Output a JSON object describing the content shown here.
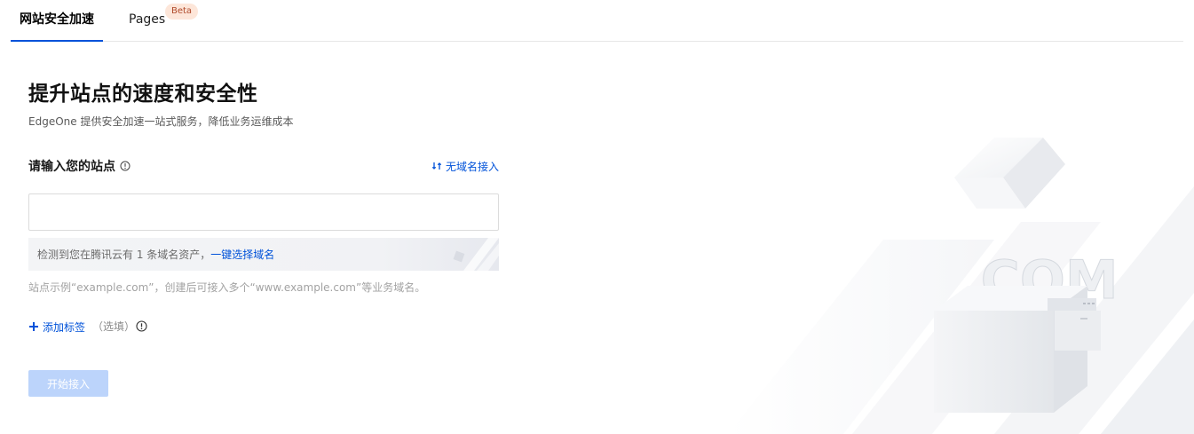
{
  "tabs": [
    {
      "label": "网站安全加速",
      "active": true
    },
    {
      "label": "Pages",
      "active": false,
      "badge": "Beta"
    }
  ],
  "main": {
    "title": "提升站点的速度和安全性",
    "subtitle": "EdgeOne 提供安全加速一站式服务，降低业务运维成本"
  },
  "site_field": {
    "label": "请输入您的站点",
    "value": "",
    "no_domain_link": "无域名接入"
  },
  "detect": {
    "text": "检测到您在腾讯云有 1 条域名资产，",
    "link": "一键选择域名"
  },
  "hint": "站点示例“example.com”，创建后可接入多个“www.example.com”等业务域名。",
  "tag": {
    "add_label": "添加标签",
    "optional_label": "（选填）"
  },
  "start_button": "开始接入",
  "hero": {
    "text": ".COM"
  },
  "colors": {
    "accent": "#0052d9",
    "disabled_button": "#bcd4fb",
    "beta_badge_bg": "#fde6d9"
  },
  "icons": [
    "info-icon",
    "swap-icon",
    "plus-icon",
    "exclamation-circle-icon"
  ]
}
